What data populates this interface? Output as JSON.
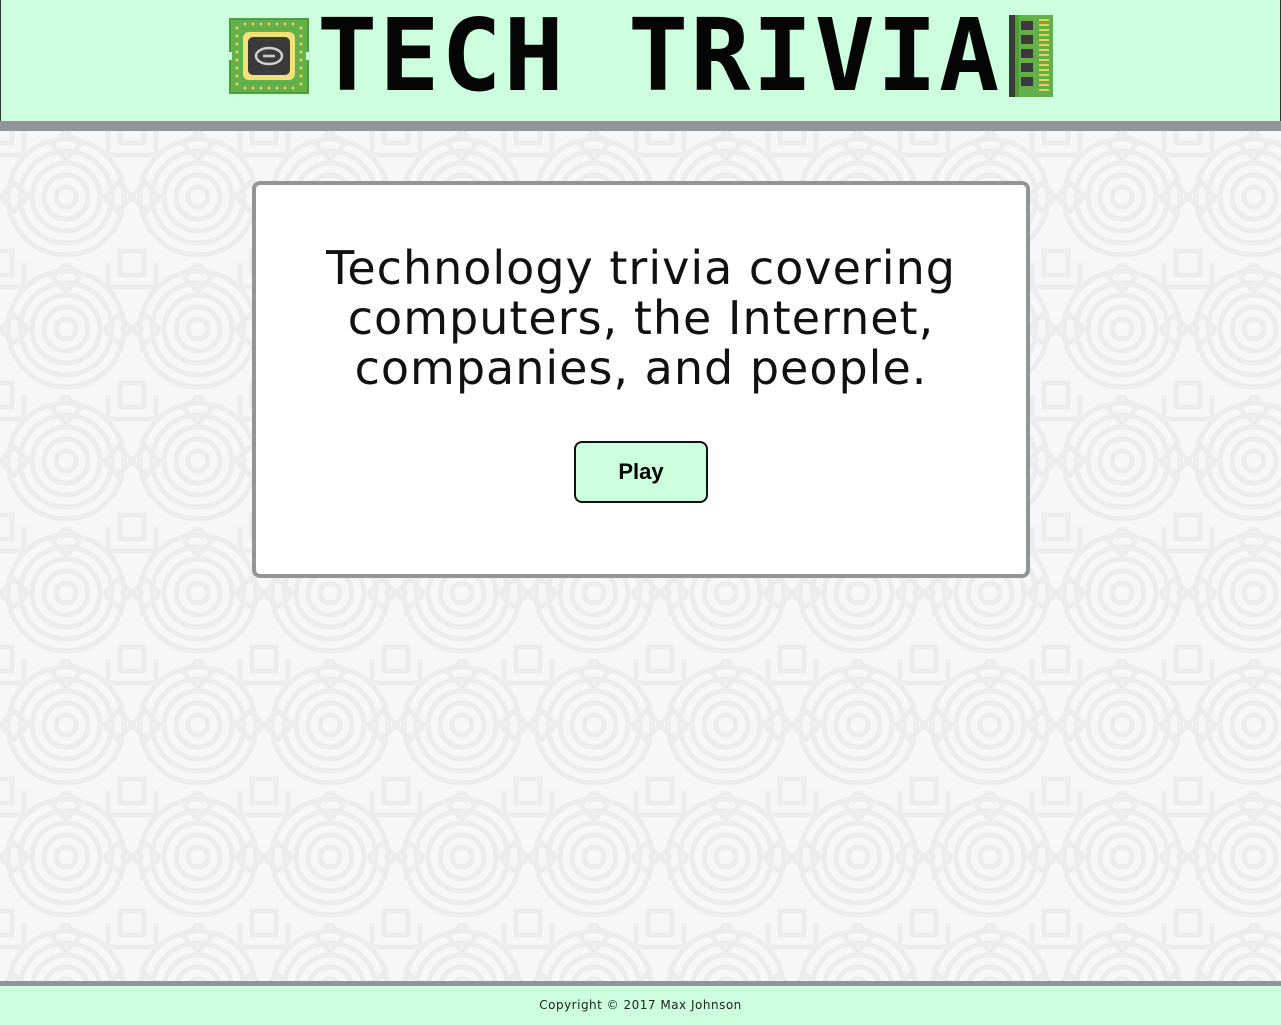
{
  "header": {
    "title": "TECH TRIVIA",
    "left_icon": "cpu-chip-icon",
    "right_icon": "ram-module-icon",
    "background_color": "#ccffdd",
    "bar_color": "#929598"
  },
  "main": {
    "description": "Technology trivia covering computers, the Internet, companies, and people.",
    "play_label": "Play"
  },
  "footer": {
    "copyright": "Copyright © 2017 Max Johnson"
  }
}
